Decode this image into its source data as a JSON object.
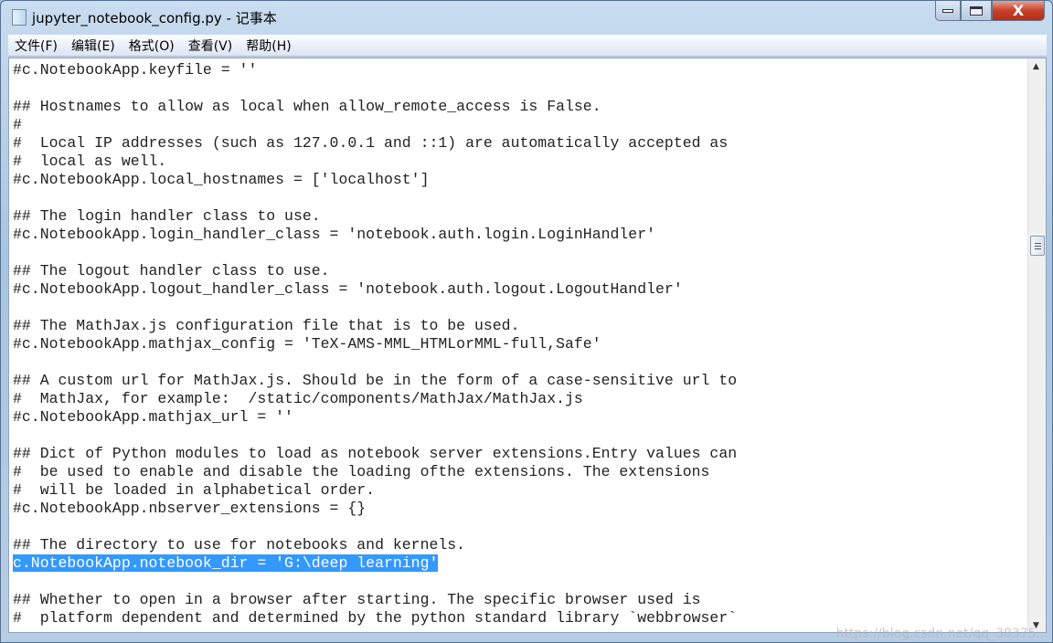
{
  "window": {
    "title": "jupyter_notebook_config.py - 记事本",
    "minimize": "minimize",
    "maximize": "maximize",
    "close": "X"
  },
  "menu": [
    "文件(F)",
    "编辑(E)",
    "格式(O)",
    "查看(V)",
    "帮助(H)"
  ],
  "lines": [
    "#c.NotebookApp.keyfile = ''",
    "",
    "## Hostnames to allow as local when allow_remote_access is False.",
    "#",
    "#  Local IP addresses (such as 127.0.0.1 and ::1) are automatically accepted as",
    "#  local as well.",
    "#c.NotebookApp.local_hostnames = ['localhost']",
    "",
    "## The login handler class to use.",
    "#c.NotebookApp.login_handler_class = 'notebook.auth.login.LoginHandler'",
    "",
    "## The logout handler class to use.",
    "#c.NotebookApp.logout_handler_class = 'notebook.auth.logout.LogoutHandler'",
    "",
    "## The MathJax.js configuration file that is to be used.",
    "#c.NotebookApp.mathjax_config = 'TeX-AMS-MML_HTMLorMML-full,Safe'",
    "",
    "## A custom url for MathJax.js. Should be in the form of a case-sensitive url to",
    "#  MathJax, for example:  /static/components/MathJax/MathJax.js",
    "#c.NotebookApp.mathjax_url = ''",
    "",
    "## Dict of Python modules to load as notebook server extensions.Entry values can",
    "#  be used to enable and disable the loading ofthe extensions. The extensions",
    "#  will be loaded in alphabetical order.",
    "#c.NotebookApp.nbserver_extensions = {}",
    "",
    "## The directory to use for notebooks and kernels.",
    "c.NotebookApp.notebook_dir = 'G:\\deep learning'",
    "",
    "## Whether to open in a browser after starting. The specific browser used is",
    "#  platform dependent and determined by the python standard library `webbrowser`"
  ],
  "selected_line": 27,
  "colors": {
    "selection": "#3399ff",
    "close_button": "#c8402a"
  },
  "watermark": "https://blog.csdn.net/qq_38375..."
}
